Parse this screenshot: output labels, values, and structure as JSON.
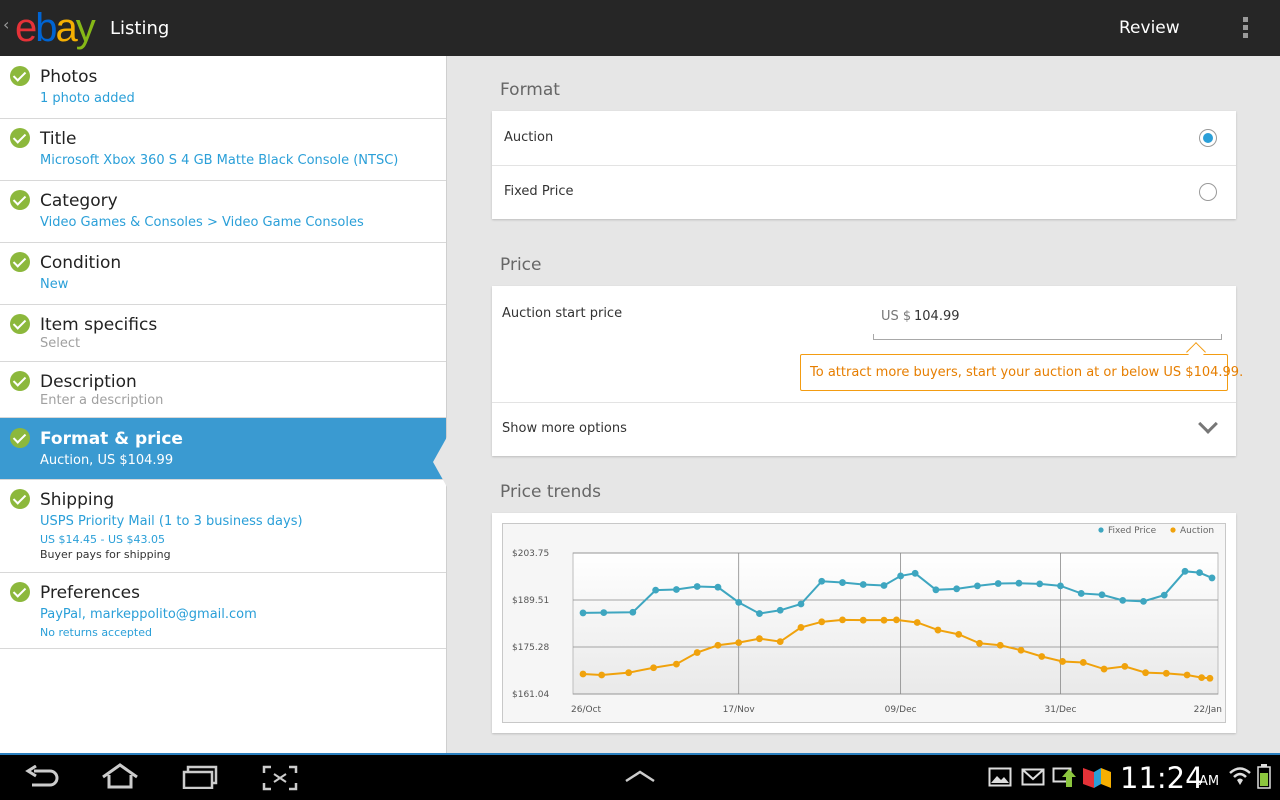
{
  "actionbar": {
    "back_glyph": "‹",
    "logo": {
      "e": "e",
      "b": "b",
      "a": "a",
      "y": "y"
    },
    "title": "Listing",
    "review_label": "Review"
  },
  "sidebar": {
    "items": [
      {
        "title": "Photos",
        "sub": "1 photo added"
      },
      {
        "title": "Title",
        "sub": "Microsoft Xbox 360 S 4 GB Matte Black Console (NTSC)"
      },
      {
        "title": "Category",
        "sub": "Video Games & Consoles > Video Game Consoles"
      },
      {
        "title": "Condition",
        "sub": "New"
      },
      {
        "title": "Item specifics",
        "sub": "Select"
      },
      {
        "title": "Description",
        "sub": "Enter a description"
      },
      {
        "title": "Format & price",
        "sub": "Auction, US $104.99"
      },
      {
        "title": "Shipping",
        "sub": "USPS Priority Mail (1 to 3 business days)",
        "sub2": "US $14.45 - US $43.05",
        "sub3": "Buyer pays for shipping"
      },
      {
        "title": "Preferences",
        "sub": "PayPal, markeppolito@gmail.com",
        "sub2": "No returns accepted"
      }
    ]
  },
  "format": {
    "header": "Format",
    "options": [
      {
        "label": "Auction",
        "selected": true
      },
      {
        "label": "Fixed Price",
        "selected": false
      }
    ]
  },
  "price": {
    "header": "Price",
    "start_label": "Auction start price",
    "currency": "US $",
    "value": "104.99",
    "hint": "To attract more buyers, start your auction at or below US $104.99.",
    "more_options": "Show more options"
  },
  "trends": {
    "header": "Price trends"
  },
  "chart_data": {
    "type": "line",
    "title": "",
    "legend": [
      "Fixed Price",
      "Auction"
    ],
    "legend_placement": "top-right",
    "colors": {
      "Fixed Price": "#3ea6c0",
      "Auction": "#f0a20c"
    },
    "yticks": [
      "$203.75",
      "$189.51",
      "$175.28",
      "$161.04"
    ],
    "ytick_values": [
      203.75,
      189.51,
      175.28,
      161.04
    ],
    "xticks": [
      "26/Oct",
      "17/Nov",
      "09/Dec",
      "31/Dec",
      "22/Jan"
    ],
    "ylim": [
      161.04,
      203.75
    ],
    "grid": true,
    "series": [
      {
        "name": "Fixed Price",
        "values": [
          185.6,
          185.7,
          185.8,
          192.5,
          192.7,
          193.6,
          193.4,
          188.8,
          185.4,
          186.4,
          188.3,
          195.2,
          194.8,
          194.2,
          193.9,
          196.8,
          197.6,
          192.6,
          192.9,
          193.8,
          194.5,
          194.6,
          194.4,
          193.8,
          191.5,
          191.1,
          189.4,
          189.1,
          191.0,
          198.2,
          197.8,
          196.2
        ],
        "x_index": [
          0,
          1,
          2.4,
          3.5,
          4.5,
          5.5,
          6.5,
          7.5,
          8.5,
          9.5,
          10.5,
          11.5,
          12.5,
          13.5,
          14.5,
          15.3,
          16,
          17,
          18,
          19,
          20,
          21,
          22,
          23,
          24,
          25,
          26,
          27,
          28,
          29,
          29.7,
          30.3
        ]
      },
      {
        "name": "Auction",
        "values": [
          167.1,
          166.8,
          167.5,
          169.0,
          170.1,
          173.6,
          175.8,
          176.6,
          177.8,
          176.9,
          181.2,
          182.9,
          183.5,
          183.4,
          183.4,
          183.5,
          182.7,
          180.4,
          179.1,
          176.4,
          175.8,
          174.3,
          172.4,
          170.9,
          170.6,
          168.6,
          169.4,
          167.5,
          167.3,
          166.8,
          166.0,
          165.8
        ],
        "x_index": [
          0,
          0.9,
          2.2,
          3.4,
          4.5,
          5.5,
          6.5,
          7.5,
          8.5,
          9.5,
          10.5,
          11.5,
          12.5,
          13.5,
          14.5,
          15.1,
          16.1,
          17.1,
          18.1,
          19.1,
          20.1,
          21.1,
          22.1,
          23.1,
          24.1,
          25.1,
          26.1,
          27.1,
          28.1,
          29.1,
          29.8,
          30.2
        ]
      }
    ]
  },
  "sysbar": {
    "clock": "11:24",
    "ampm": "AM"
  }
}
